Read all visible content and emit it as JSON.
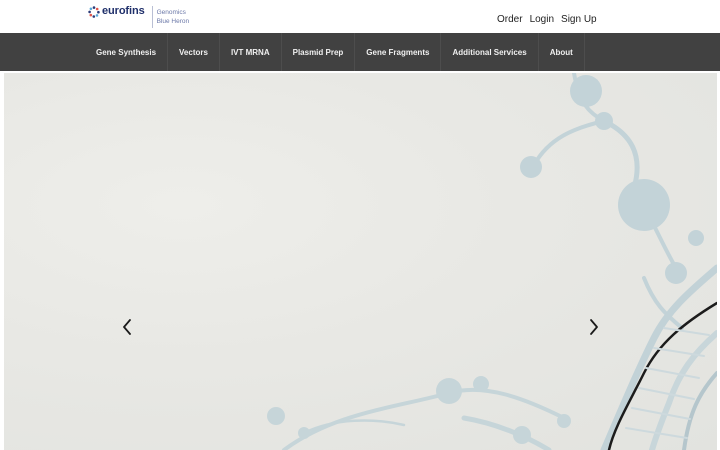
{
  "header": {
    "brand": "eurofins",
    "sub_line_1": "Genomics",
    "sub_line_2": "Blue Heron",
    "links": [
      "Order",
      "Login",
      "Sign Up"
    ]
  },
  "nav": {
    "items": [
      "Gene Synthesis",
      "Vectors",
      "IVT MRNA",
      "Plasmid Prep",
      "Gene Fragments",
      "Additional Services",
      "About"
    ]
  },
  "carousel": {
    "prev_icon": "chevron-left-icon",
    "next_icon": "chevron-right-icon"
  },
  "colors": {
    "brand_navy": "#1f2f6a",
    "nav_background": "#414141",
    "hero_background": "#e8e8e4",
    "molecule_blue": "#b9ccd3"
  }
}
